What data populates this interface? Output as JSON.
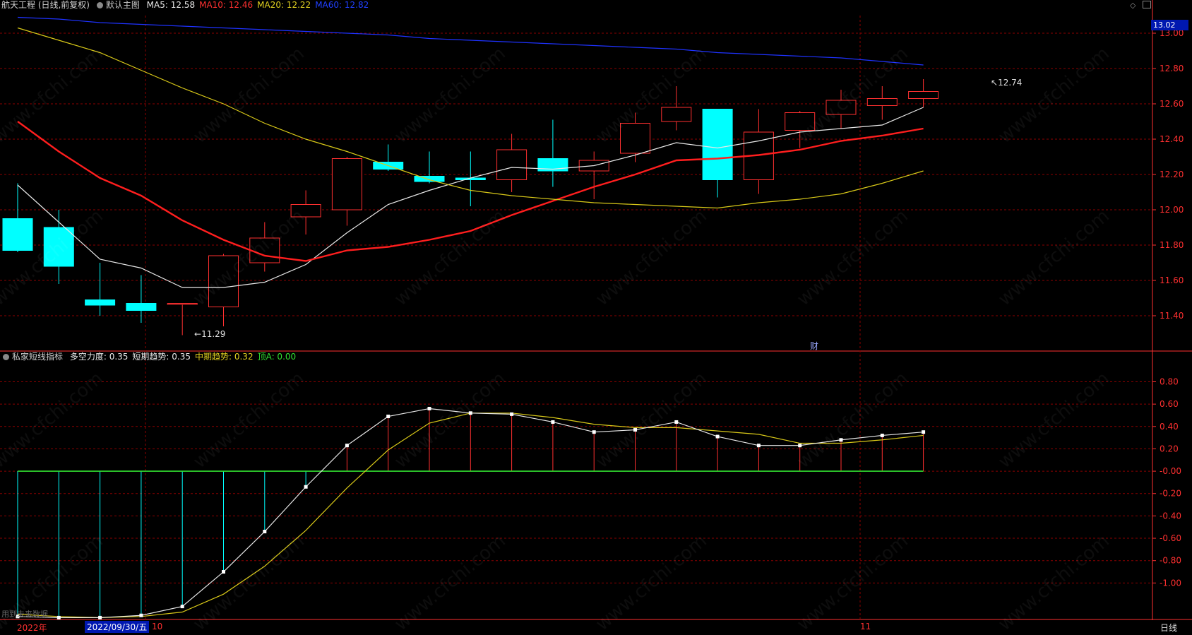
{
  "header": {
    "title": "航天工程 (日线,前复权)",
    "template": "默认主图",
    "ma_labels": [
      {
        "text": "MA5: 12.58",
        "color": "#e8e8e8"
      },
      {
        "text": "MA10: 12.46",
        "color": "#ff3030"
      },
      {
        "text": "MA20: 12.22",
        "color": "#e0d020"
      },
      {
        "text": "MA60: 12.82",
        "color": "#2040ff"
      }
    ]
  },
  "sub_header": {
    "name": "私家短线指标",
    "labels": [
      {
        "text": "多空力度: 0.35",
        "color": "#e8e8e8"
      },
      {
        "text": "短期趋势: 0.35",
        "color": "#e8e8e8"
      },
      {
        "text": "中期趋势: 0.32",
        "color": "#e0d020"
      },
      {
        "text": "顶A: 0.00",
        "color": "#30e030"
      }
    ]
  },
  "markers": {
    "high": "12.74",
    "low": "11.29",
    "fin": "财",
    "price_tag": "13.02"
  },
  "bottom": {
    "year": "2022年",
    "date": "2022/09/30/五",
    "m10": "10",
    "m11": "11",
    "period": "日线",
    "left_note": "用到未来数据"
  },
  "colors": {
    "up": "#ff3030",
    "down": "#00ffff",
    "grid": "#8b0000",
    "axis": "#ff3030"
  },
  "chart_data": [
    {
      "type": "candlestick",
      "title": "航天工程 (日线,前复权)",
      "ylim": [
        11.2,
        13.1
      ],
      "yticks": [
        "13.00",
        "12.80",
        "12.60",
        "12.40",
        "12.20",
        "12.00",
        "11.80",
        "11.60",
        "11.40"
      ],
      "ohlc": [
        [
          11.95,
          12.15,
          11.76,
          11.77
        ],
        [
          11.9,
          12.0,
          11.58,
          11.68
        ],
        [
          11.49,
          11.7,
          11.4,
          11.46
        ],
        [
          11.47,
          11.63,
          11.36,
          11.43
        ],
        [
          11.47,
          11.47,
          11.29,
          11.47
        ],
        [
          11.45,
          11.75,
          11.34,
          11.74
        ],
        [
          11.7,
          11.93,
          11.65,
          11.84
        ],
        [
          11.96,
          12.11,
          11.86,
          12.03
        ],
        [
          12.0,
          12.3,
          11.91,
          12.29
        ],
        [
          12.27,
          12.37,
          12.22,
          12.23
        ],
        [
          12.19,
          12.33,
          12.15,
          12.16
        ],
        [
          12.18,
          12.33,
          12.02,
          12.17
        ],
        [
          12.17,
          12.43,
          12.1,
          12.34
        ],
        [
          12.29,
          12.51,
          12.13,
          12.22
        ],
        [
          12.22,
          12.33,
          12.06,
          12.28
        ],
        [
          12.32,
          12.55,
          12.27,
          12.49
        ],
        [
          12.5,
          12.7,
          12.45,
          12.58
        ],
        [
          12.57,
          12.57,
          12.07,
          12.17
        ],
        [
          12.17,
          12.57,
          12.09,
          12.44
        ],
        [
          12.45,
          12.56,
          12.35,
          12.55
        ],
        [
          12.54,
          12.68,
          12.46,
          12.62
        ],
        [
          12.59,
          12.7,
          12.51,
          12.63
        ],
        [
          12.63,
          12.74,
          12.58,
          12.67
        ]
      ],
      "series": [
        {
          "name": "MA5",
          "color": "#e8e8e8",
          "width": 1.2,
          "values": [
            12.14,
            11.93,
            11.72,
            11.67,
            11.56,
            11.56,
            11.59,
            11.69,
            11.87,
            12.03,
            12.11,
            12.18,
            12.24,
            12.23,
            12.25,
            12.31,
            12.38,
            12.35,
            12.39,
            12.44,
            12.46,
            12.48,
            12.58
          ]
        },
        {
          "name": "MA10",
          "color": "#ff1e1e",
          "width": 2.4,
          "values": [
            12.5,
            12.33,
            12.18,
            12.08,
            11.94,
            11.83,
            11.74,
            11.71,
            11.77,
            11.79,
            11.83,
            11.88,
            11.97,
            12.05,
            12.13,
            12.2,
            12.28,
            12.29,
            12.31,
            12.34,
            12.39,
            12.42,
            12.46
          ]
        },
        {
          "name": "MA20",
          "color": "#d8c818",
          "width": 1.2,
          "values": [
            13.03,
            12.96,
            12.89,
            12.79,
            12.69,
            12.6,
            12.49,
            12.4,
            12.33,
            12.25,
            12.17,
            12.11,
            12.08,
            12.06,
            12.04,
            12.03,
            12.02,
            12.01,
            12.04,
            12.06,
            12.09,
            12.15,
            12.22
          ]
        },
        {
          "name": "MA60",
          "color": "#1e32ff",
          "width": 1.2,
          "values": [
            13.09,
            13.08,
            13.06,
            13.05,
            13.04,
            13.03,
            13.02,
            13.01,
            13.0,
            12.99,
            12.97,
            12.96,
            12.95,
            12.94,
            12.93,
            12.92,
            12.91,
            12.89,
            12.88,
            12.87,
            12.86,
            12.84,
            12.82
          ]
        }
      ]
    },
    {
      "type": "line",
      "title": "私家短线指标",
      "ylim": [
        -1.32,
        0.98
      ],
      "yticks": [
        "0.80",
        "0.60",
        "0.40",
        "0.20",
        "-0.00",
        "-0.20",
        "-0.40",
        "-0.60",
        "-0.80",
        "-1.00"
      ],
      "series": [
        {
          "name": "多空力度",
          "color": "#e8e8e8",
          "values": [
            -1.3,
            -1.31,
            -1.31,
            -1.29,
            -1.21,
            -0.9,
            -0.54,
            -0.14,
            0.23,
            0.49,
            0.56,
            0.52,
            0.51,
            0.44,
            0.35,
            0.37,
            0.44,
            0.31,
            0.23,
            0.23,
            0.28,
            0.32,
            0.35
          ]
        },
        {
          "name": "中期趋势",
          "color": "#d8c818",
          "values": [
            -1.28,
            -1.3,
            -1.31,
            -1.3,
            -1.26,
            -1.1,
            -0.85,
            -0.53,
            -0.15,
            0.19,
            0.43,
            0.52,
            0.52,
            0.48,
            0.42,
            0.39,
            0.39,
            0.36,
            0.33,
            0.25,
            0.25,
            0.28,
            0.32
          ]
        },
        {
          "name": "顶A",
          "color": "#30e030",
          "values": [
            0,
            0,
            0,
            0,
            0,
            0,
            0,
            0,
            0,
            0,
            0,
            0,
            0,
            0,
            0,
            0,
            0,
            0,
            0,
            0,
            0,
            0,
            0
          ]
        }
      ]
    }
  ]
}
